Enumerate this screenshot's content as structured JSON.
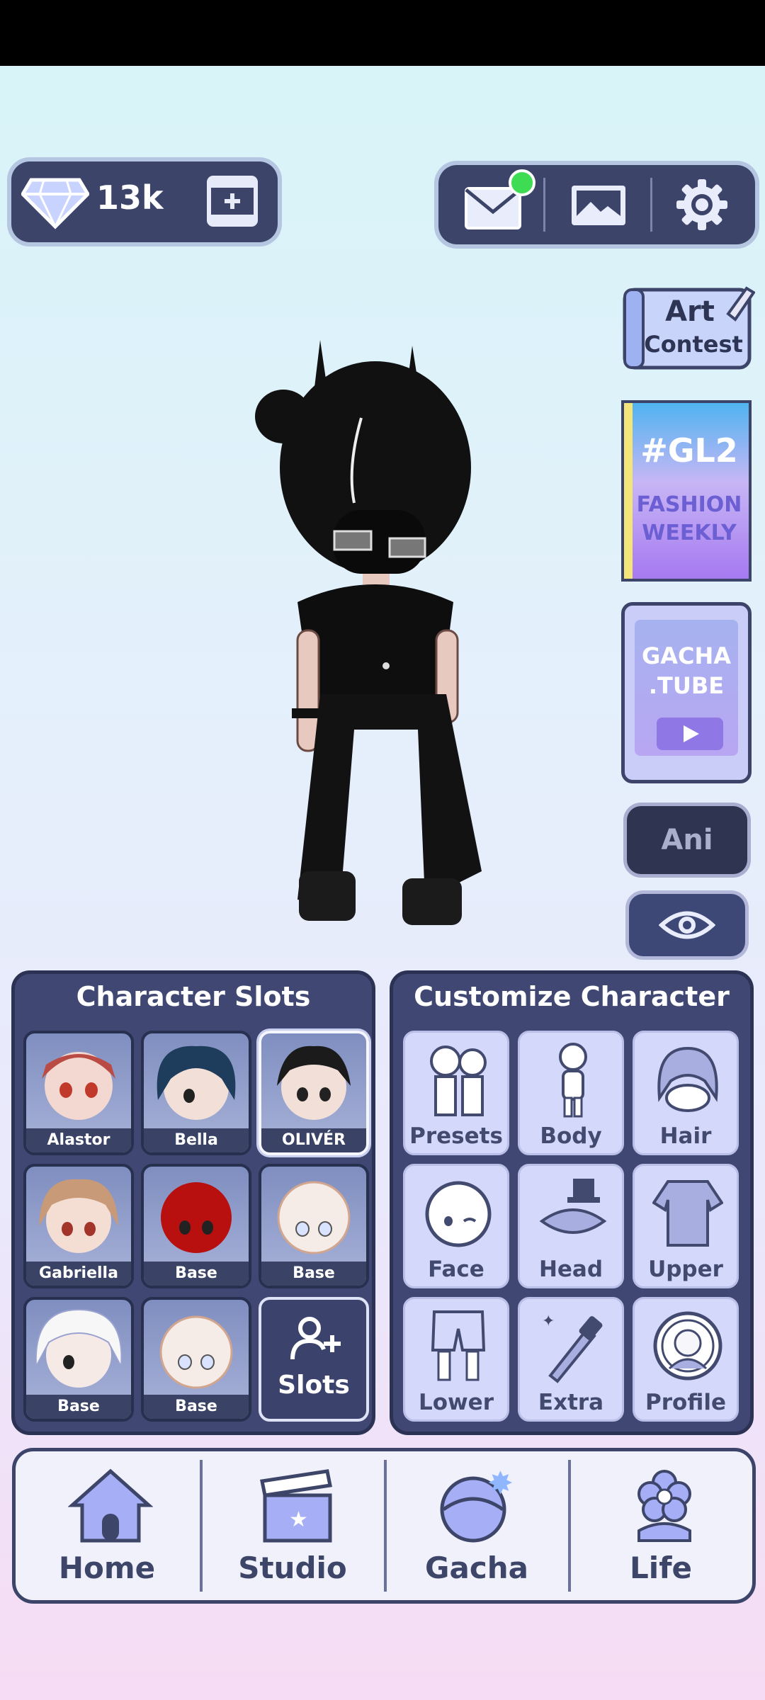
{
  "top_bar": {
    "gem_count": "13k",
    "icons": [
      "diamond-icon",
      "add-video-icon",
      "mail-icon",
      "gallery-icon",
      "gear-icon"
    ]
  },
  "side_buttons": {
    "art_contest": [
      "Art",
      "Contest"
    ],
    "gl2": {
      "tag": "#GL2",
      "line1": "FASHION",
      "line2": "WEEKLY"
    },
    "gacha_tube": [
      "GACHA",
      ".TUBE"
    ],
    "ani_label": "Ani"
  },
  "character_slots": {
    "title": "Character Slots",
    "slots": [
      {
        "name": "Alastor",
        "selected": false
      },
      {
        "name": "Bella",
        "selected": false
      },
      {
        "name": "OLIVÉR",
        "selected": true
      },
      {
        "name": "Gabriella",
        "selected": false
      },
      {
        "name": "Base",
        "selected": false
      },
      {
        "name": "Base",
        "selected": false
      },
      {
        "name": "Base",
        "selected": false
      },
      {
        "name": "Base",
        "selected": false
      }
    ],
    "add_slots_label": "Slots"
  },
  "customize": {
    "title": "Customize Character",
    "items": [
      "Presets",
      "Body",
      "Hair",
      "Face",
      "Head",
      "Upper",
      "Lower",
      "Extra",
      "Profile"
    ]
  },
  "nav": {
    "items": [
      "Home",
      "Studio",
      "Gacha",
      "Life"
    ]
  },
  "colors": {
    "panel": "#3f4772",
    "accent_green": "#3ddc52",
    "nav_text": "#3d4569"
  }
}
